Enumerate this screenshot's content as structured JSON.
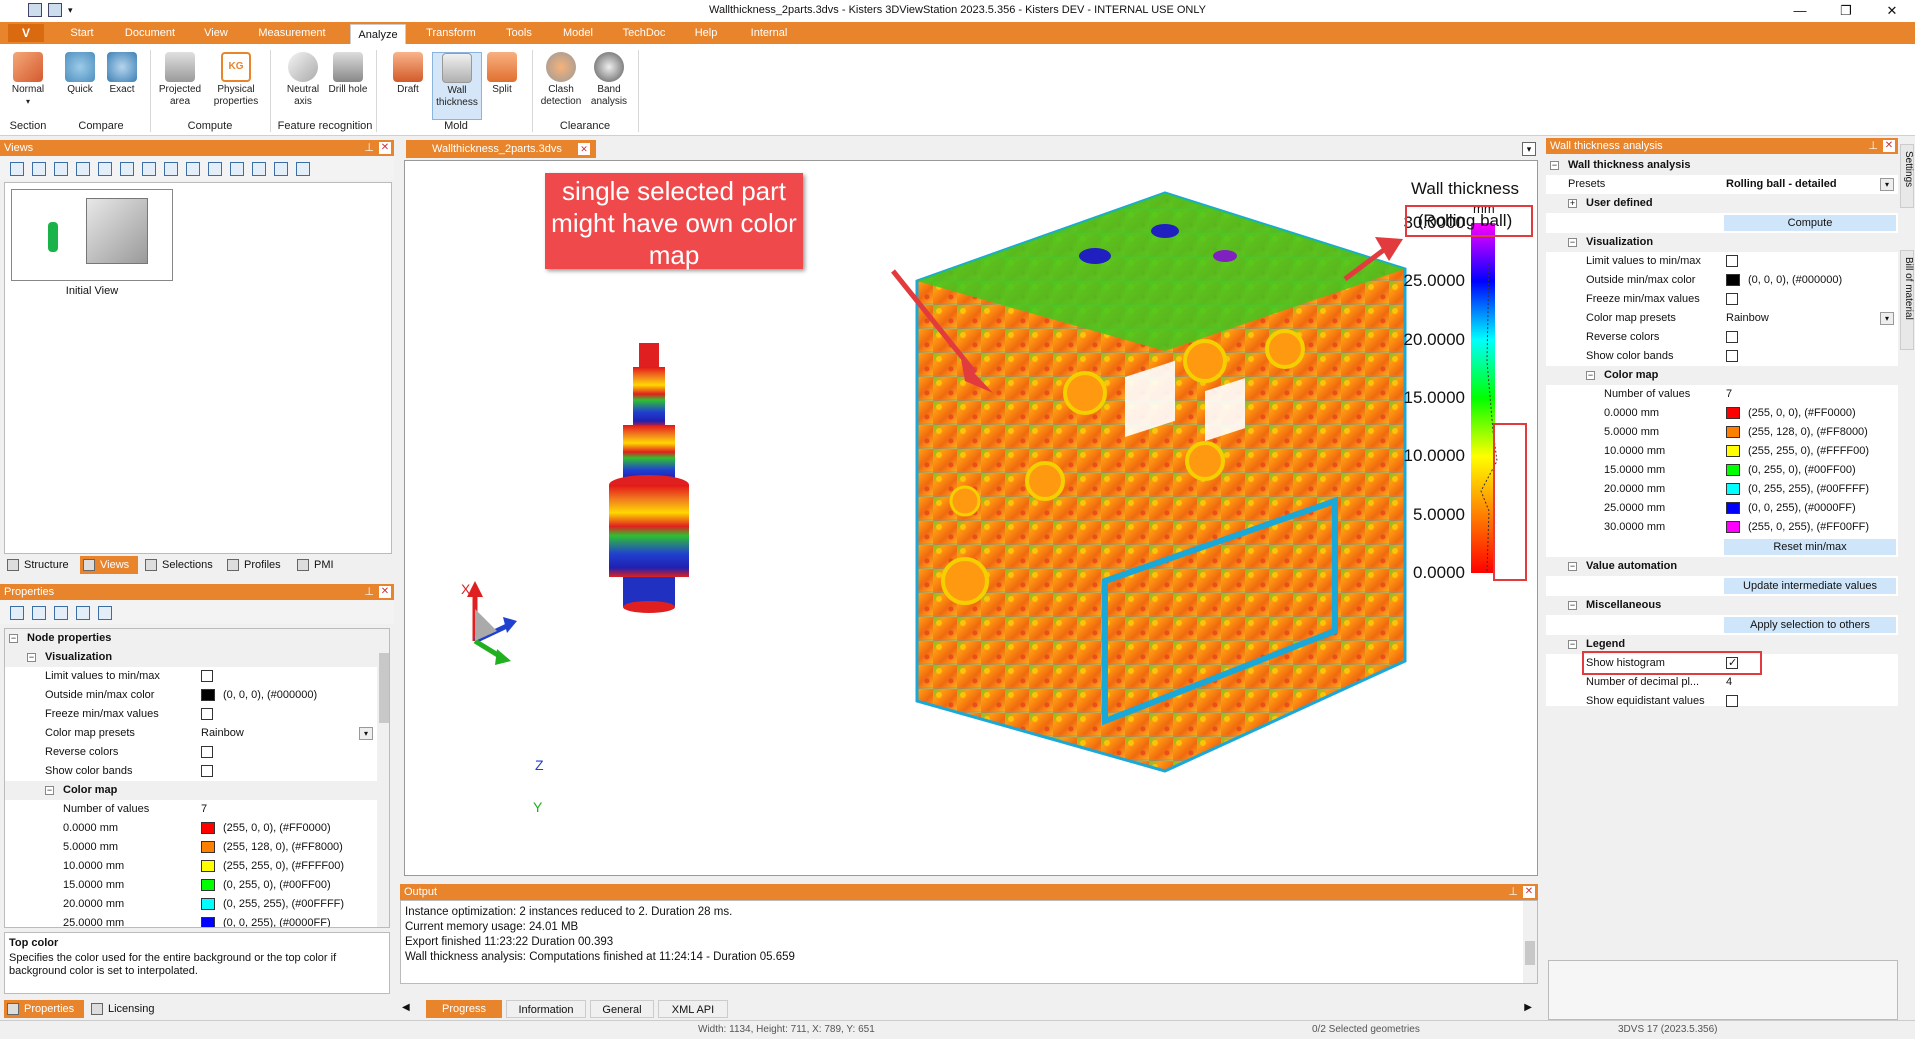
{
  "window": {
    "title": "Wallthickness_2parts.3dvs - Kisters 3DViewStation 2023.5.356 - Kisters DEV - INTERNAL USE ONLY",
    "minimize": "—",
    "maximize": "❐",
    "close": "✕"
  },
  "menu": {
    "app_button": "V",
    "items": [
      "Start",
      "Document",
      "View",
      "Measurement",
      "Analyze",
      "Transform",
      "Tools",
      "Model",
      "TechDoc",
      "Help",
      "Internal"
    ],
    "active": "Analyze"
  },
  "ribbon": {
    "buttons": [
      {
        "label": "Normal",
        "icon": "section-normal-icon"
      },
      {
        "label": "Quick",
        "icon": "compare-quick-icon"
      },
      {
        "label": "Exact",
        "icon": "compare-exact-icon"
      },
      {
        "label": "Projected area",
        "icon": "projected-area-icon"
      },
      {
        "label": "Physical properties",
        "icon": "physical-properties-icon"
      },
      {
        "label": "Neutral axis",
        "icon": "neutral-axis-icon"
      },
      {
        "label": "Drill hole",
        "icon": "drill-hole-icon"
      },
      {
        "label": "Draft",
        "icon": "draft-icon"
      },
      {
        "label": "Wall thickness",
        "icon": "wall-thickness-icon"
      },
      {
        "label": "Split",
        "icon": "split-icon"
      },
      {
        "label": "Clash detection",
        "icon": "clash-detection-icon"
      },
      {
        "label": "Band analysis",
        "icon": "band-analysis-icon"
      }
    ],
    "groups": [
      "Section",
      "Compare",
      "Compute",
      "Feature recognition",
      "Mold",
      "Clearance"
    ]
  },
  "views_panel": {
    "title": "Views",
    "thumbnail_label": "Initial View",
    "tabs": [
      "Structure",
      "Views",
      "Selections",
      "Profiles",
      "PMI"
    ],
    "active_tab": "Views"
  },
  "properties_panel": {
    "title": "Properties",
    "rows": {
      "node_properties": "Node properties",
      "visualization": "Visualization",
      "limit": "Limit values to min/max",
      "outside": "Outside min/max color",
      "outside_value": "(0, 0, 0), (#000000)",
      "freeze": "Freeze min/max values",
      "presets": "Color map presets",
      "presets_value": "Rainbow",
      "reverse": "Reverse colors",
      "bands": "Show color bands",
      "colormap": "Color map",
      "num_values": "Number of values",
      "num_values_value": "7"
    },
    "colors": [
      {
        "label": "0.0000 mm",
        "value": "(255, 0, 0), (#FF0000)",
        "hex": "#FF0000"
      },
      {
        "label": "5.0000 mm",
        "value": "(255, 128, 0), (#FF8000)",
        "hex": "#FF8000"
      },
      {
        "label": "10.0000 mm",
        "value": "(255, 255, 0), (#FFFF00)",
        "hex": "#FFFF00"
      },
      {
        "label": "15.0000 mm",
        "value": "(0, 255, 0), (#00FF00)",
        "hex": "#00FF00"
      },
      {
        "label": "20.0000 mm",
        "value": "(0, 255, 255), (#00FFFF)",
        "hex": "#00FFFF"
      },
      {
        "label": "25.0000 mm",
        "value": "(0, 0, 255), (#0000FF)",
        "hex": "#0000FF"
      }
    ],
    "help_title": "Top color",
    "help_text": "Specifies the color used for the entire background or the top color if background color is set to interpolated.",
    "tabs": [
      "Properties",
      "Licensing"
    ],
    "active_tab": "Properties"
  },
  "document_tab": "Wallthickness_2parts.3dvs",
  "viewport": {
    "legend_title": "Wall thickness",
    "legend_subtitle": "(Rolling ball)",
    "legend_unit": "mm",
    "legend_values": [
      "30.0000",
      "25.0000",
      "20.0000",
      "15.0000",
      "10.0000",
      "5.0000",
      "0.0000"
    ],
    "callout": "single selected part might have own color map",
    "axis_labels": {
      "x": "X",
      "y": "Y",
      "z": "Z"
    }
  },
  "output_panel": {
    "title": "Output",
    "lines": [
      "Instance optimization: 2 instances reduced to 2. Duration 28 ms.",
      "Current memory usage: 24.01 MB",
      "Export finished 11:23:22 Duration 00.393",
      "Wall thickness analysis: Computations finished at 11:24:14  - Duration 05.659"
    ],
    "tabs": [
      "Progress",
      "Information",
      "General",
      "XML API"
    ],
    "active_tab": "Progress"
  },
  "wt_panel": {
    "title": "Wall thickness analysis",
    "section": "Wall thickness analysis",
    "presets_label": "Presets",
    "presets_value": "Rolling ball - detailed",
    "user_defined": "User defined",
    "compute": "Compute",
    "visualization": "Visualization",
    "limit": "Limit values to min/max",
    "outside": "Outside min/max color",
    "outside_value": "(0, 0, 0), (#000000)",
    "freeze": "Freeze min/max values",
    "cm_presets": "Color map presets",
    "cm_presets_value": "Rainbow",
    "reverse": "Reverse colors",
    "bands": "Show color bands",
    "colormap": "Color map",
    "num_values": "Number of values",
    "num_values_value": "7",
    "colors": [
      {
        "label": "0.0000 mm",
        "value": "(255, 0, 0), (#FF0000)",
        "hex": "#FF0000"
      },
      {
        "label": "5.0000 mm",
        "value": "(255, 128, 0), (#FF8000)",
        "hex": "#FF8000"
      },
      {
        "label": "10.0000 mm",
        "value": "(255, 255, 0), (#FFFF00)",
        "hex": "#FFFF00"
      },
      {
        "label": "15.0000 mm",
        "value": "(0, 255, 0), (#00FF00)",
        "hex": "#00FF00"
      },
      {
        "label": "20.0000 mm",
        "value": "(0, 255, 255), (#00FFFF)",
        "hex": "#00FFFF"
      },
      {
        "label": "25.0000 mm",
        "value": "(0, 0, 255), (#0000FF)",
        "hex": "#0000FF"
      },
      {
        "label": "30.0000 mm",
        "value": "(255, 0, 255), (#FF00FF)",
        "hex": "#FF00FF"
      }
    ],
    "reset": "Reset min/max",
    "value_automation": "Value automation",
    "update": "Update intermediate values",
    "misc": "Miscellaneous",
    "apply": "Apply selection to others",
    "legend": "Legend",
    "show_histogram": "Show histogram",
    "decimal": "Number of decimal pl...",
    "decimal_value": "4",
    "equidistant": "Show equidistant values",
    "side_tabs": [
      "Settings",
      "Bill of material"
    ]
  },
  "statusbar": {
    "dims": "Width: 1134, Height: 711, X: 789, Y: 651",
    "selected": "0/2 Selected geometries",
    "version": "3DVS 17 (2023.5.356)"
  }
}
